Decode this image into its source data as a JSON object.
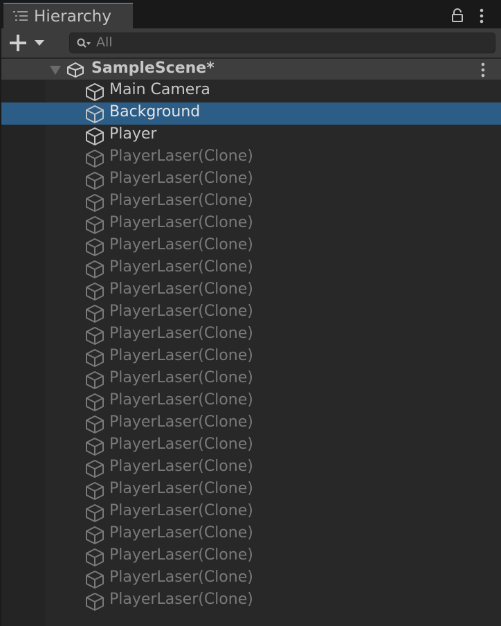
{
  "window": {
    "tab_title": "Hierarchy",
    "tab_icon": "list-icon",
    "lock_icon": "lock-icon",
    "menu_icon": "kebab-menu-icon"
  },
  "toolbar": {
    "add_icon": "plus-icon",
    "dropdown_icon": "caret-down-icon",
    "search_placeholder": "All",
    "search_icon": "search-icon"
  },
  "scene": {
    "name": "SampleScene*",
    "icon": "unity-icon",
    "expanded": true
  },
  "colors": {
    "selection": "#2c5d87",
    "accent": "#3a79bb",
    "inactive_text": "#7a7a7a",
    "active_text": "#c8c8c8"
  },
  "objects": [
    {
      "label": "Main Camera",
      "active": true,
      "selected": false
    },
    {
      "label": "Background",
      "active": true,
      "selected": true
    },
    {
      "label": "Player",
      "active": true,
      "selected": false
    },
    {
      "label": "PlayerLaser(Clone)",
      "active": false,
      "selected": false
    },
    {
      "label": "PlayerLaser(Clone)",
      "active": false,
      "selected": false
    },
    {
      "label": "PlayerLaser(Clone)",
      "active": false,
      "selected": false
    },
    {
      "label": "PlayerLaser(Clone)",
      "active": false,
      "selected": false
    },
    {
      "label": "PlayerLaser(Clone)",
      "active": false,
      "selected": false
    },
    {
      "label": "PlayerLaser(Clone)",
      "active": false,
      "selected": false
    },
    {
      "label": "PlayerLaser(Clone)",
      "active": false,
      "selected": false
    },
    {
      "label": "PlayerLaser(Clone)",
      "active": false,
      "selected": false
    },
    {
      "label": "PlayerLaser(Clone)",
      "active": false,
      "selected": false
    },
    {
      "label": "PlayerLaser(Clone)",
      "active": false,
      "selected": false
    },
    {
      "label": "PlayerLaser(Clone)",
      "active": false,
      "selected": false
    },
    {
      "label": "PlayerLaser(Clone)",
      "active": false,
      "selected": false
    },
    {
      "label": "PlayerLaser(Clone)",
      "active": false,
      "selected": false
    },
    {
      "label": "PlayerLaser(Clone)",
      "active": false,
      "selected": false
    },
    {
      "label": "PlayerLaser(Clone)",
      "active": false,
      "selected": false
    },
    {
      "label": "PlayerLaser(Clone)",
      "active": false,
      "selected": false
    },
    {
      "label": "PlayerLaser(Clone)",
      "active": false,
      "selected": false
    },
    {
      "label": "PlayerLaser(Clone)",
      "active": false,
      "selected": false
    },
    {
      "label": "PlayerLaser(Clone)",
      "active": false,
      "selected": false
    },
    {
      "label": "PlayerLaser(Clone)",
      "active": false,
      "selected": false
    },
    {
      "label": "PlayerLaser(Clone)",
      "active": false,
      "selected": false
    }
  ]
}
